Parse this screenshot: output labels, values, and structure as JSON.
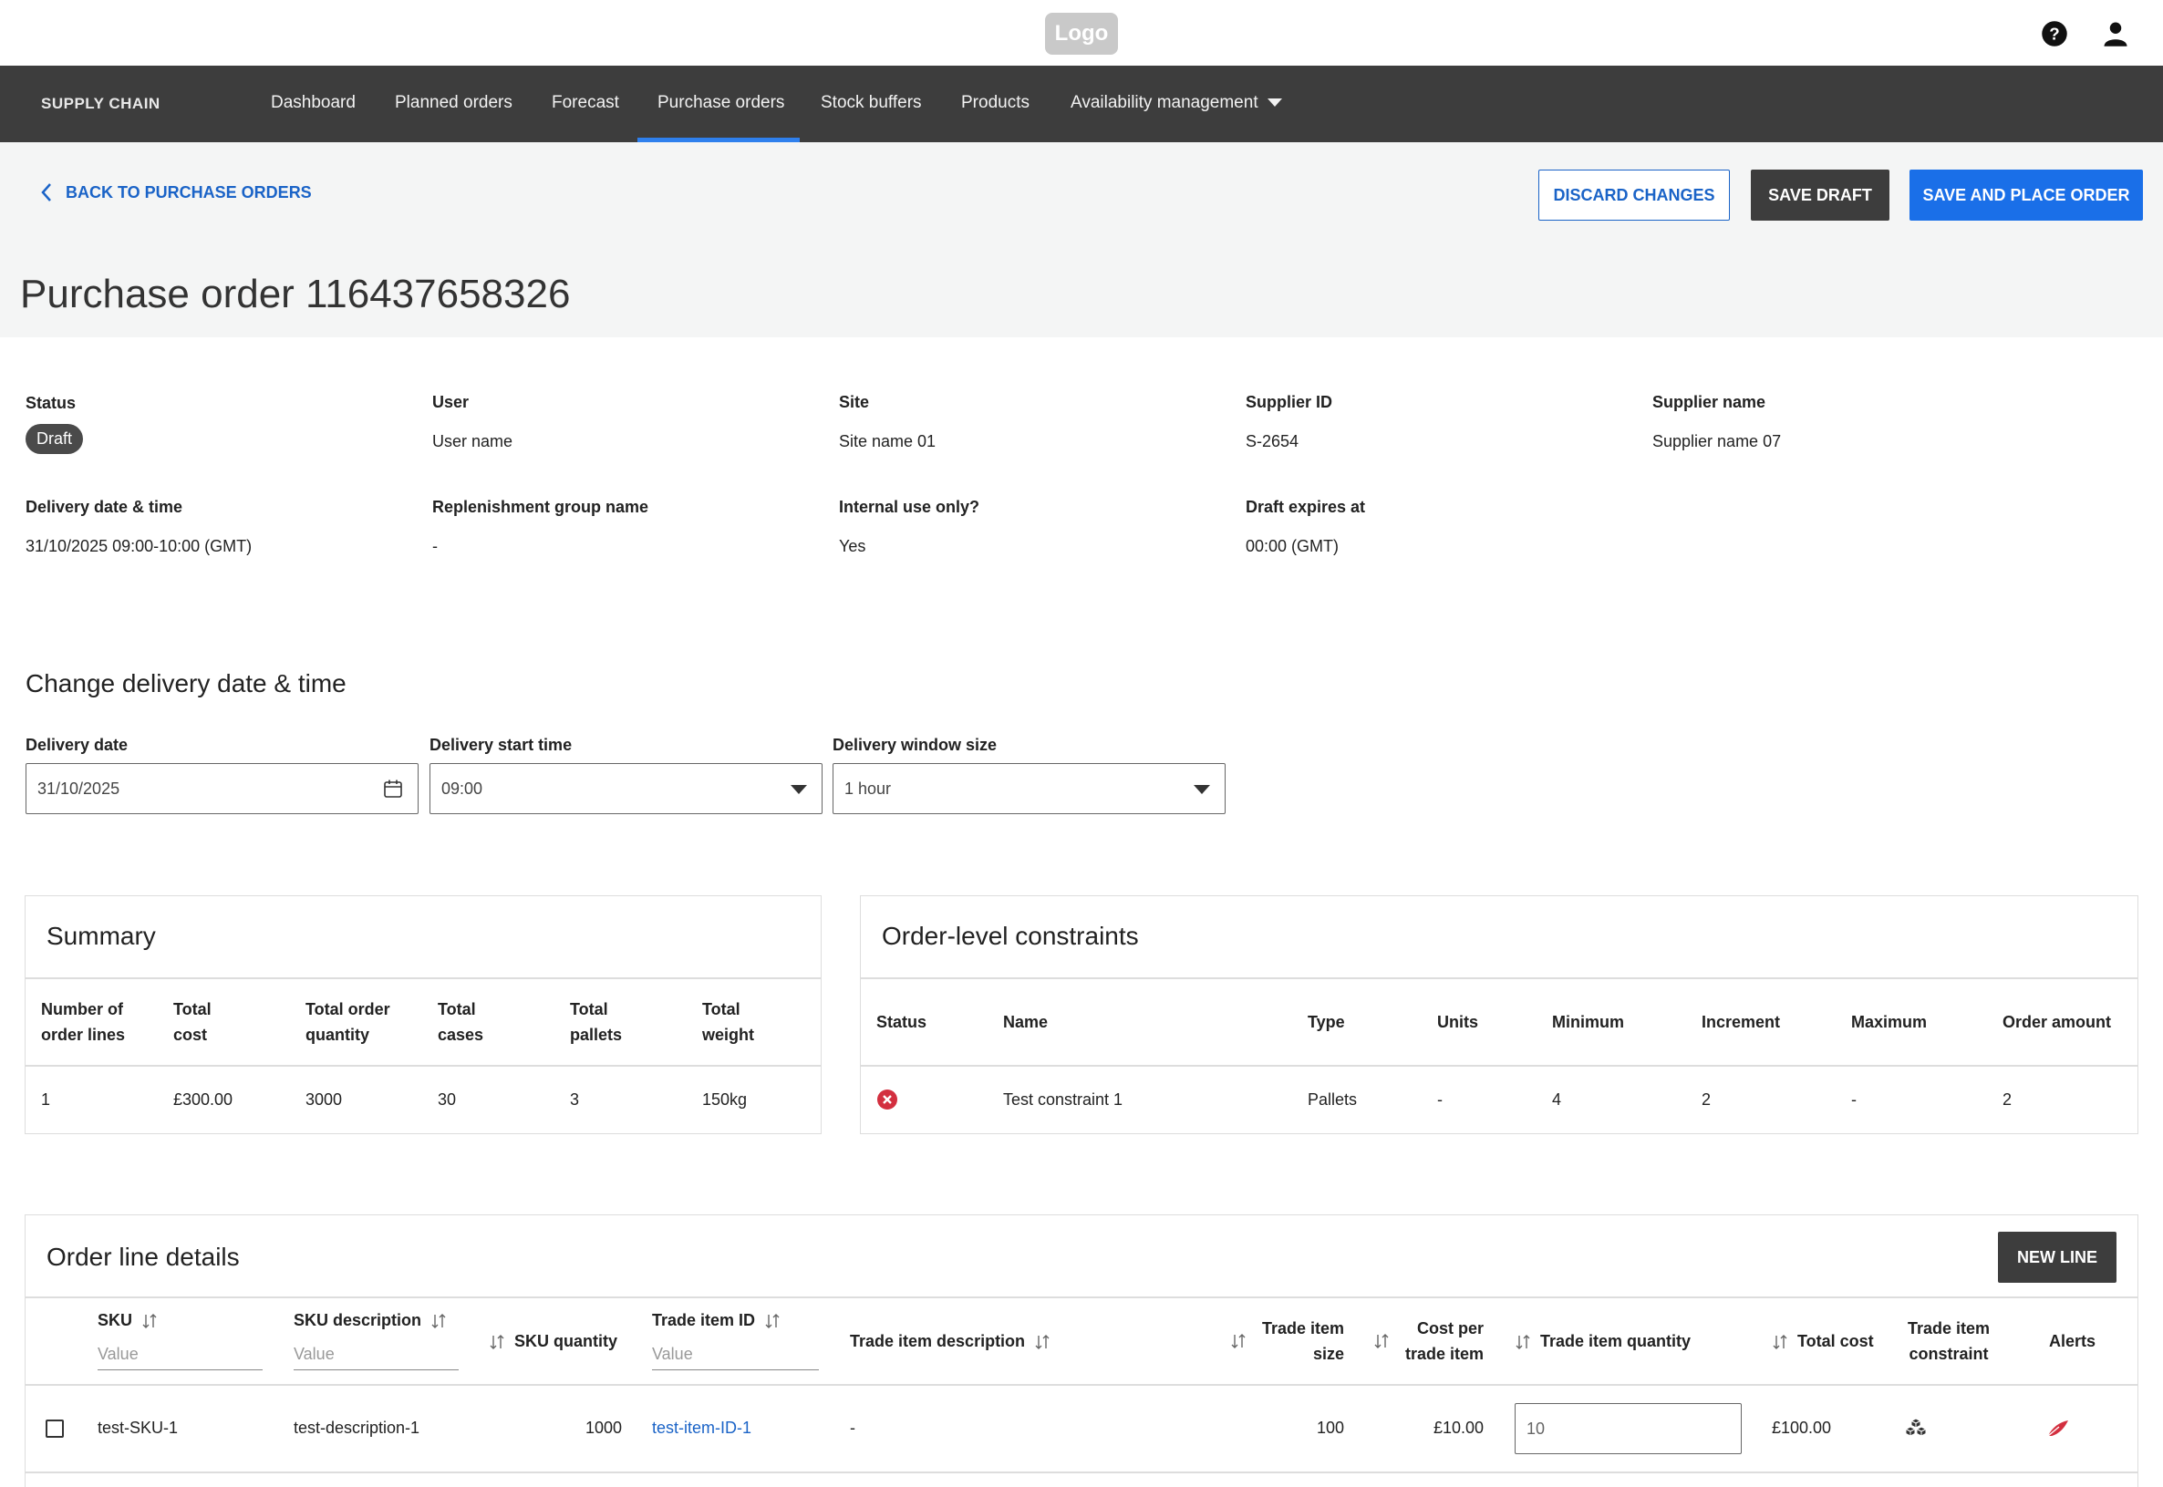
{
  "topbar": {
    "logo": "Logo"
  },
  "nav": {
    "brand": "SUPPLY CHAIN",
    "items": [
      "Dashboard",
      "Planned orders",
      "Forecast",
      "Purchase orders",
      "Stock buffers",
      "Products",
      "Availability management"
    ],
    "active": "Purchase orders"
  },
  "header": {
    "back_label": "BACK TO PURCHASE ORDERS",
    "discard_label": "DISCARD CHANGES",
    "save_draft_label": "SAVE DRAFT",
    "place_label": "SAVE AND PLACE ORDER",
    "title": "Purchase order 116437658326"
  },
  "details": {
    "status_label": "Status",
    "status_value": "Draft",
    "user_label": "User",
    "user_value": "User name",
    "site_label": "Site",
    "site_value": "Site name 01",
    "supplier_id_label": "Supplier ID",
    "supplier_id_value": "S-2654",
    "supplier_name_label": "Supplier name",
    "supplier_name_value": "Supplier name 07",
    "delivery_label": "Delivery date & time",
    "delivery_value": "31/10/2025 09:00-10:00 (GMT)",
    "replenishment_label": "Replenishment group name",
    "replenishment_value": "-",
    "internal_label": "Internal use only?",
    "internal_value": "Yes",
    "expires_label": "Draft expires at",
    "expires_value": "00:00 (GMT)"
  },
  "change_delivery": {
    "title": "Change delivery date & time",
    "date_label": "Delivery date",
    "date_value": "31/10/2025",
    "start_label": "Delivery start time",
    "start_value": "09:00",
    "window_label": "Delivery window size",
    "window_value": "1 hour"
  },
  "summary": {
    "title": "Summary",
    "headers": [
      "Number of order lines",
      "Total cost",
      "Total order quantity",
      "Total cases",
      "Total pallets",
      "Total weight"
    ],
    "values": [
      "1",
      "£300.00",
      "3000",
      "30",
      "3",
      "150kg"
    ]
  },
  "constraints": {
    "title": "Order-level constraints",
    "headers": [
      "Status",
      "Name",
      "Type",
      "Units",
      "Minimum",
      "Increment",
      "Maximum",
      "Order amount"
    ],
    "row": [
      "Test constraint 1",
      "Pallets",
      "-",
      "4",
      "2",
      "-",
      "2"
    ],
    "status_color": "#d32f3f"
  },
  "order_lines": {
    "title": "Order line details",
    "new_line_label": "NEW LINE",
    "headers": {
      "sku": "SKU",
      "sku_desc": "SKU description",
      "sku_qty": "SKU quantity",
      "trade_id": "Trade item ID",
      "trade_desc": "Trade item description",
      "trade_size": "Trade item size",
      "cost_per": "Cost per trade item",
      "trade_qty": "Trade item quantity",
      "total_cost": "Total cost",
      "trade_constraint": "Trade item constraint",
      "alerts": "Alerts"
    },
    "filter_placeholder": "Value",
    "row": {
      "sku": "test-SKU-1",
      "sku_desc": "test-description-1",
      "sku_qty": "1000",
      "trade_id": "test-item-ID-1",
      "trade_desc": "-",
      "trade_size": "100",
      "cost_per": "£10.00",
      "trade_qty": "10",
      "total_cost": "£100.00"
    },
    "alert_color": "#d32f3f"
  }
}
